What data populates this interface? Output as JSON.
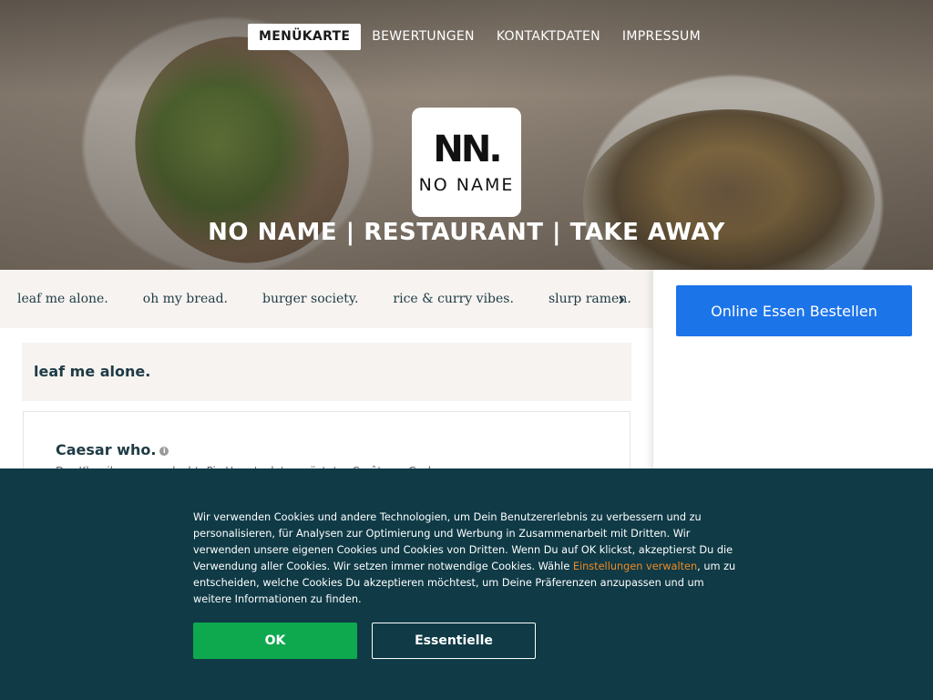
{
  "nav": {
    "items": [
      {
        "label": "MENÜKARTE",
        "active": true
      },
      {
        "label": "BEWERTUNGEN",
        "active": false
      },
      {
        "label": "KONTAKTDATEN",
        "active": false
      },
      {
        "label": "IMPRESSUM",
        "active": false
      }
    ]
  },
  "logo": {
    "mark": "NN.",
    "text": "NO NAME"
  },
  "hero": {
    "title": "NO NAME | RESTAURANT | TAKE AWAY"
  },
  "categories": {
    "items": [
      "leaf me alone.",
      "oh my bread.",
      "burger society.",
      "rice & curry vibes.",
      "slurp ramen."
    ],
    "next_icon": "chevron-right-icon"
  },
  "sidebar": {
    "order_button": "Online Essen Bestellen"
  },
  "menu": {
    "section_title": "leaf me alone.",
    "dish": {
      "name": "Caesar who.",
      "info_icon": "info-icon",
      "description": "Der Klassiker neu gedacht: Pic Hauptsalat, gerösteter Croûtons, Gurke..."
    }
  },
  "cookie": {
    "text_before": "Wir verwenden Cookies und andere Technologien, um Dein Benutzererlebnis zu verbessern und zu personalisieren, für Analysen zur Optimierung und Werbung in Zusammenarbeit mit Dritten. Wir verwenden unsere eigenen Cookies und Cookies von Dritten. Wenn Du auf OK klickst, akzeptierst Du die Verwendung aller Cookies. Wir setzen immer notwendige Cookies. Wähle ",
    "link": "Einstellungen verwalten",
    "text_after": ", um zu entscheiden, welche Cookies Du akzeptieren möchtest, um Deine Präferenzen anzupassen und um weitere Informationen zu finden.",
    "ok_button": "OK",
    "essential_button": "Essentielle"
  },
  "colors": {
    "accent_blue": "#1c74e9",
    "ok_green": "#0ea84f",
    "banner_bg": "#0f3a46",
    "link_orange": "#f08a24"
  }
}
